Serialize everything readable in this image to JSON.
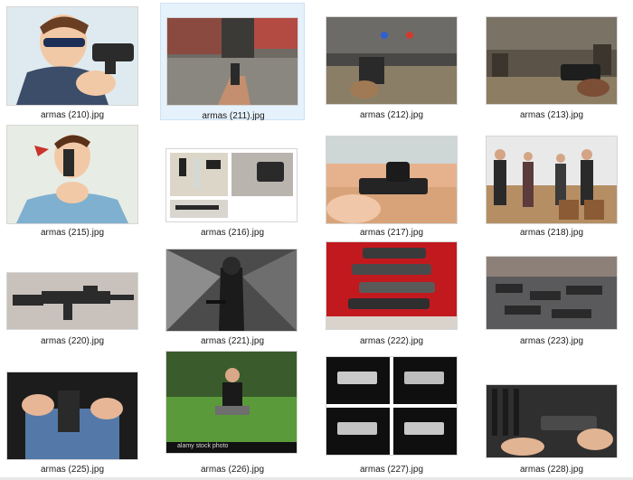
{
  "files": [
    {
      "name": "armas (210).jpg",
      "selected": false
    },
    {
      "name": "armas (211).jpg",
      "selected": true
    },
    {
      "name": "armas (212).jpg",
      "selected": false
    },
    {
      "name": "armas (213).jpg",
      "selected": false
    },
    {
      "name": "armas (215).jpg",
      "selected": false
    },
    {
      "name": "armas (216).jpg",
      "selected": false
    },
    {
      "name": "armas (217).jpg",
      "selected": false
    },
    {
      "name": "armas (218).jpg",
      "selected": false
    },
    {
      "name": "armas (220).jpg",
      "selected": false
    },
    {
      "name": "armas (221).jpg",
      "selected": false
    },
    {
      "name": "armas (222).jpg",
      "selected": false
    },
    {
      "name": "armas (223).jpg",
      "selected": false
    },
    {
      "name": "armas (225).jpg",
      "selected": false
    },
    {
      "name": "armas (226).jpg",
      "selected": false
    },
    {
      "name": "armas (227).jpg",
      "selected": false
    },
    {
      "name": "armas (228).jpg",
      "selected": false
    }
  ],
  "watermark_226": "alamy stock photo",
  "colors": {
    "selection": "#e5f1fb",
    "selection_border": "#cde3f7"
  }
}
